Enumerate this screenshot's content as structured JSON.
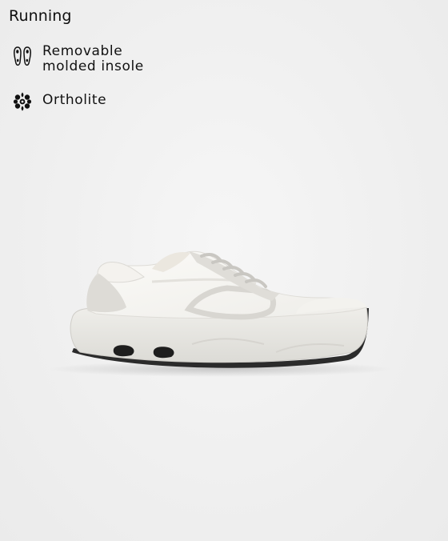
{
  "category": "Running",
  "features": [
    {
      "icon": "insole-icon",
      "lines": [
        "Removable",
        "molded insole"
      ]
    },
    {
      "icon": "ortholite-icon",
      "label": "Ortholite"
    }
  ],
  "product_image": {
    "subject": "white running sneaker",
    "colors": {
      "upper": "#f7f6f3",
      "sole": "#e9e8e4",
      "outsole": "#2b2b2b",
      "overlay": "#dcdad5"
    }
  }
}
